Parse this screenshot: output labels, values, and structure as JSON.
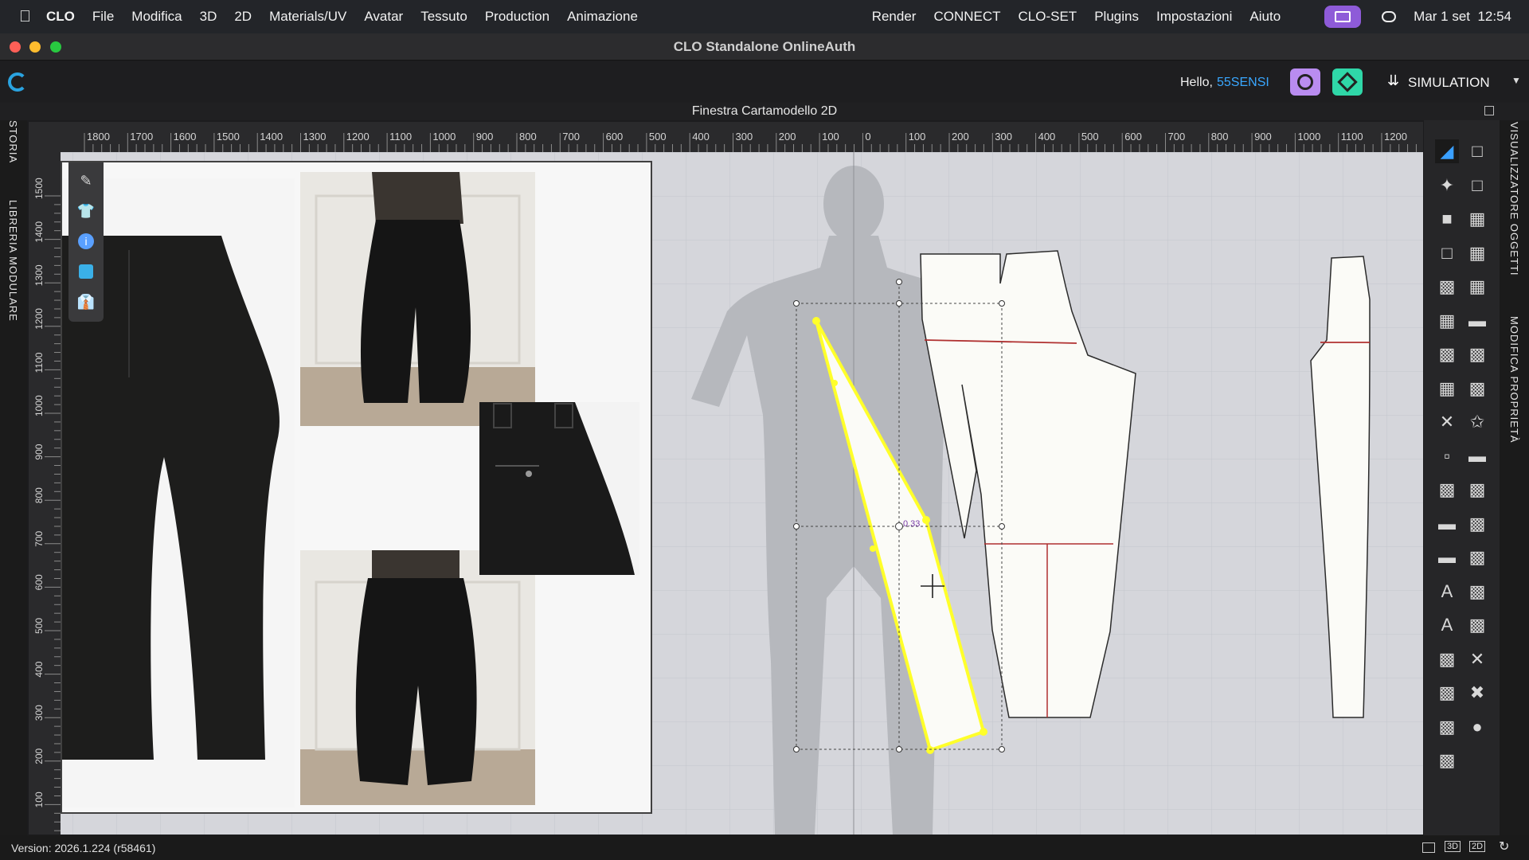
{
  "menubar": {
    "app": "CLO",
    "items": [
      "File",
      "Modifica",
      "3D",
      "2D",
      "Materials/UV",
      "Avatar",
      "Tessuto",
      "Production",
      "Animazione"
    ],
    "right_items": [
      "Render",
      "CONNECT",
      "CLO-SET",
      "Plugins",
      "Impostazioni",
      "Aiuto"
    ],
    "datetime": "Mar 1 set  12:54"
  },
  "window": {
    "title": "CLO Standalone OnlineAuth"
  },
  "toolbar": {
    "hello": "Hello,",
    "user": "55SENSI",
    "mode": "SIMULATION"
  },
  "pattern_window": {
    "title": "Finestra Cartamodello 2D"
  },
  "left_tabs": [
    "STORIA",
    "LIBRERIA MODULARE"
  ],
  "right_tabs": [
    "VISUALIZZATORE OGGETTI",
    "MODIFICA PROPRIETÀ"
  ],
  "ruler": {
    "h_ticks": [
      "1800",
      "1700",
      "1600",
      "1500",
      "1400",
      "1300",
      "1200",
      "1100",
      "1000",
      "900",
      "800",
      "700",
      "600",
      "500",
      "400",
      "300",
      "200",
      "100",
      "0",
      "100",
      "200",
      "300",
      "400",
      "500",
      "600",
      "700",
      "800",
      "900",
      "1000",
      "1100",
      "1200"
    ],
    "v_ticks": [
      "1500",
      "1400",
      "1300",
      "1200",
      "1100",
      "1000",
      "900",
      "800",
      "700",
      "600",
      "500",
      "400",
      "300",
      "200",
      "100"
    ]
  },
  "measure_value": "0.33",
  "status": {
    "version": "Version: 2026.1.224 (r58461)"
  },
  "colors": {
    "accent": "#39a7ff",
    "selection": "#ffff2a",
    "seam": "#b03030",
    "brand": "#2aa3e0"
  }
}
